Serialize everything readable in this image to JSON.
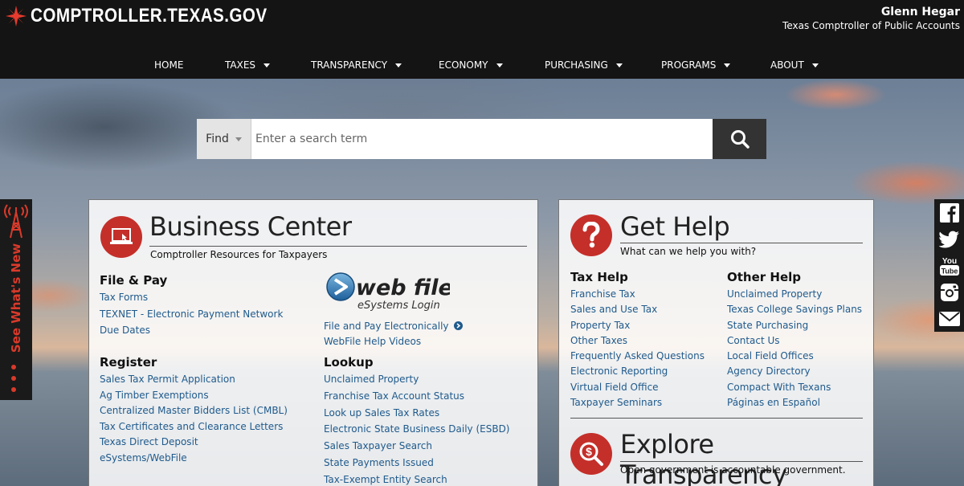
{
  "header": {
    "logo_text": "COMPTROLLER.TEXAS.GOV",
    "official_name": "Glenn Hegar",
    "official_title": "Texas Comptroller of Public Accounts"
  },
  "nav": [
    {
      "label": "HOME",
      "caret": false
    },
    {
      "label": "TAXES",
      "caret": true
    },
    {
      "label": "TRANSPARENCY",
      "caret": true
    },
    {
      "label": "ECONOMY",
      "caret": true
    },
    {
      "label": "PURCHASING",
      "caret": true
    },
    {
      "label": "PROGRAMS",
      "caret": true
    },
    {
      "label": "ABOUT",
      "caret": true
    }
  ],
  "search": {
    "find_label": "Find",
    "placeholder": "Enter a search term"
  },
  "side_tab": {
    "label": "See What's New"
  },
  "social": [
    "facebook-icon",
    "twitter-icon",
    "youtube-icon",
    "instagram-icon",
    "email-icon"
  ],
  "business_center": {
    "title": "Business Center",
    "subtitle": "Comptroller Resources for Taxpayers",
    "file_pay": {
      "heading": "File & Pay",
      "links": [
        "Tax Forms",
        "TEXNET - Electronic Payment Network",
        "Due Dates"
      ]
    },
    "register": {
      "heading": "Register",
      "links": [
        "Sales Tax Permit Application",
        "Ag Timber Exemptions",
        "Centralized Master Bidders List (CMBL)",
        "Tax Certificates and Clearance Letters",
        "Texas Direct Deposit",
        "eSystems/WebFile"
      ]
    },
    "webfile": {
      "logo_main": "web file",
      "logo_sub": "eSystems Login",
      "links": [
        "File and Pay Electronically",
        "WebFile Help Videos"
      ]
    },
    "lookup": {
      "heading": "Lookup",
      "links": [
        "Unclaimed Property",
        "Franchise Tax Account Status",
        "Look up Sales Tax Rates",
        "Electronic State Business Daily (ESBD)",
        "Sales Taxpayer Search",
        "State Payments Issued",
        "Tax-Exempt Entity Search"
      ]
    }
  },
  "get_help": {
    "title": "Get Help",
    "subtitle": "What can we help you with?",
    "tax_help": {
      "heading": "Tax Help",
      "links": [
        "Franchise Tax",
        "Sales and Use Tax",
        "Property Tax",
        "Other Taxes",
        "Frequently Asked Questions",
        "Electronic Reporting",
        "Virtual Field Office",
        "Taxpayer Seminars"
      ]
    },
    "other_help": {
      "heading": "Other Help",
      "links": [
        "Unclaimed Property",
        "Texas College Savings Plans",
        "State Purchasing",
        "Contact Us",
        "Local Field Offices",
        "Agency Directory",
        "Compact With Texans",
        "Páginas en Español"
      ]
    },
    "explore": {
      "title": "Explore Transparency",
      "subtitle": "Open government is accountable government."
    }
  },
  "colors": {
    "header_bg": "#141414",
    "accent_red": "#c42f2a",
    "link_blue": "#1f5a8c"
  }
}
